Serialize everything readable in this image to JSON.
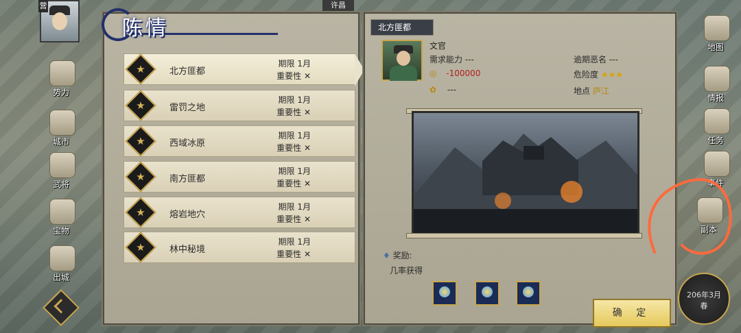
{
  "title": "陈情",
  "top_city": "许昌",
  "badge": "营",
  "left_list": [
    {
      "name": "北方匪都",
      "limit": "期限 1月",
      "importance": "重要性"
    },
    {
      "name": "雷罚之地",
      "limit": "期限 1月",
      "importance": "重要性"
    },
    {
      "name": "西域冰原",
      "limit": "期限 1月",
      "importance": "重要性"
    },
    {
      "name": "南方匪都",
      "limit": "期限 1月",
      "importance": "重要性"
    },
    {
      "name": "熔岩地穴",
      "limit": "期限 1月",
      "importance": "重要性"
    },
    {
      "name": "林中秘境",
      "limit": "期限 1月",
      "importance": "重要性"
    }
  ],
  "detail": {
    "region": "北方匪都",
    "role": "文官",
    "required_ability": "需求能力 ---",
    "overdue": "逾期恶名 ---",
    "money": "-100000",
    "danger_label": "危险度",
    "danger_stars": "★★★",
    "grain": "---",
    "location_label": "地点",
    "location": "庐江",
    "reward_label": "奖励:",
    "reward_note": "几率获得"
  },
  "buttons": {
    "confirm": "确 定"
  },
  "side_menu_left": [
    "势力",
    "城市",
    "武将",
    "宝物",
    "出城"
  ],
  "side_menu_right": [
    "地图",
    "情报",
    "任务",
    "事件",
    "副本"
  ],
  "date": {
    "line1": "206年3月",
    "line2": "春"
  }
}
